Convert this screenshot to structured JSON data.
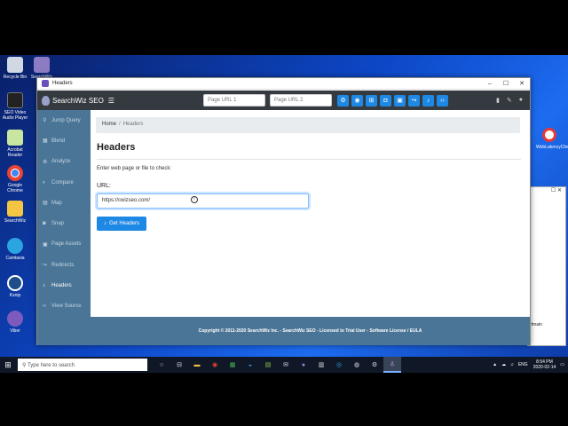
{
  "desktop": {
    "icons": [
      {
        "label": "Recycle Bin"
      },
      {
        "label": "SearchWiz"
      },
      {
        "label": "SEO Video Audio Player"
      },
      {
        "label": "Acrobat Reader"
      },
      {
        "label": "Google Chrome"
      },
      {
        "label": "SearchWiz"
      },
      {
        "label": "Camtasia"
      },
      {
        "label": "Ksnip"
      },
      {
        "label": "Viber"
      }
    ],
    "web_icon_label": "WebLatencyCheck"
  },
  "window": {
    "title": "Headers",
    "controls": [
      "–",
      "☐",
      "✕"
    ]
  },
  "navbar": {
    "brand": "SearchWiz SEO",
    "url1_placeholder": "Page URL 1",
    "url2_placeholder": "Page URL 2"
  },
  "sidebar": {
    "items": [
      {
        "label": "Jump Query",
        "icon": "link-icon"
      },
      {
        "label": "Blend",
        "icon": "blend-icon"
      },
      {
        "label": "Analyze",
        "icon": "cogs-icon"
      },
      {
        "label": "Compare",
        "icon": "compare-icon"
      },
      {
        "label": "Map",
        "icon": "map-icon"
      },
      {
        "label": "Snap",
        "icon": "camera-icon"
      },
      {
        "label": "Page Assets",
        "icon": "assets-icon"
      },
      {
        "label": "Redirects",
        "icon": "redirect-icon"
      },
      {
        "label": "Headers",
        "icon": "bell-icon"
      },
      {
        "label": "View Source",
        "icon": "code-icon"
      }
    ],
    "active": "Headers"
  },
  "main": {
    "breadcrumb": {
      "home": "Home",
      "current": "Headers"
    },
    "title": "Headers",
    "hint": "Enter web page or file to check:",
    "url_label": "URL:",
    "url_value": "https://cwizseo.com/",
    "button_label": "Get Headers",
    "footer": "Copyright © 2011-2020 SearchWiz Inc. - SearchWiz SEO - Licensed to Trial User - Software License / EULA"
  },
  "taskbar": {
    "search_placeholder": "Type here to search",
    "language": "ENG",
    "time": "8:54 PM",
    "date": "2020-02-14"
  },
  "background_window": {
    "text": "rtmain"
  }
}
